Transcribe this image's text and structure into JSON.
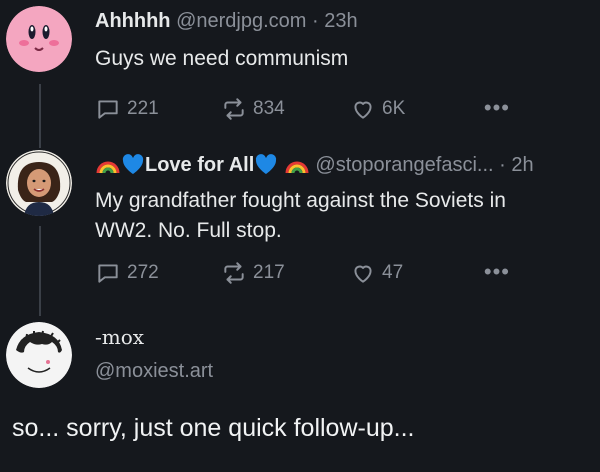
{
  "posts": [
    {
      "name": "Ahhhhh",
      "handle": "@nerdjpg.com",
      "separator": "·",
      "time": "23h",
      "text": "Guys we need communism",
      "replies": "221",
      "reposts": "834",
      "likes": "6K",
      "avatar": "kirby-avatar"
    },
    {
      "name": "Love for All",
      "handle": "@stoporangefasci...",
      "separator": "·",
      "time": "2h",
      "text": "My grandfather fought against the Soviets in WW2. No. Full stop.",
      "replies": "272",
      "reposts": "217",
      "likes": "47",
      "avatar": "cartoon-woman-avatar",
      "name_emojis": [
        "rainbow",
        "blue-heart",
        "blue-heart",
        "rainbow"
      ]
    },
    {
      "name": "-mox",
      "handle": "@moxiest.art",
      "avatar": "sketch-avatar"
    }
  ],
  "footer_text": "so... sorry, just one quick follow-up...",
  "more_label": "•••"
}
